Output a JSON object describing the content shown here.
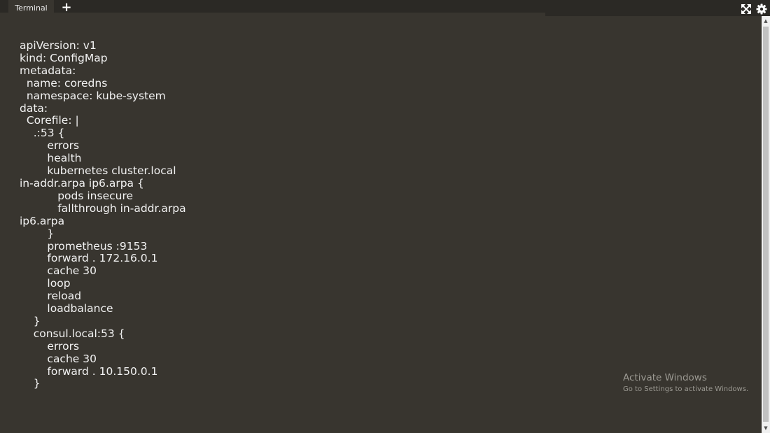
{
  "tabbar": {
    "tab_label": "Terminal",
    "add_tab_glyph": "+"
  },
  "toolbar": {
    "fullscreen_icon": "expand-arrows-icon",
    "settings_icon": "gear-icon"
  },
  "terminal": {
    "text_color": "#f2f2f2",
    "background": "#38352f",
    "output": "apiVersion: v1\nkind: ConfigMap\nmetadata:\n  name: coredns\n  namespace: kube-system\ndata:\n  Corefile: |\n    .:53 {\n        errors\n        health\n        kubernetes cluster.local\nin-addr.arpa ip6.arpa {\n           pods insecure\n           fallthrough in-addr.arpa\nip6.arpa\n        }\n        prometheus :9153\n        forward . 172.16.0.1\n        cache 30\n        loop\n        reload\n        loadbalance\n    }\n    consul.local:53 {\n        errors\n        cache 30\n        forward . 10.150.0.1\n    }"
  },
  "scrollbar": {
    "up_glyph": "▲",
    "down_glyph": "▼"
  },
  "watermark": {
    "title": "Activate Windows",
    "subtitle": "Go to Settings to activate Windows."
  }
}
